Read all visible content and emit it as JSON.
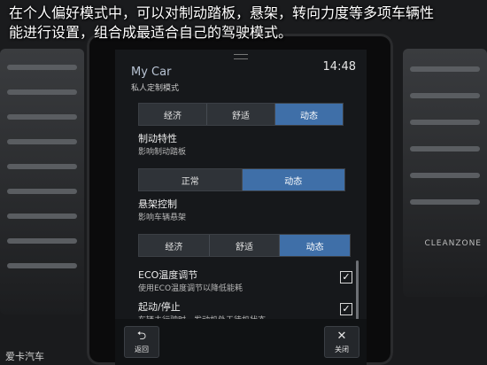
{
  "caption": {
    "line1": "在个人偏好模式中，可以对制动踏板，悬架，转向力度等多项车辆性",
    "line2": "能进行设置，组合成最适合自己的驾驶模式。"
  },
  "header": {
    "title": "My Car",
    "subtitle": "私人定制模式",
    "time": "14:48"
  },
  "top_selector": {
    "options": [
      "经济",
      "舒适",
      "动态"
    ],
    "active": "动态"
  },
  "brake": {
    "title": "制动特性",
    "subtitle": "影响制动踏板",
    "options": [
      "正常",
      "动态"
    ],
    "active": "动态"
  },
  "suspension": {
    "title": "悬架控制",
    "subtitle": "影响车辆悬架",
    "options": [
      "经济",
      "舒适",
      "动态"
    ],
    "active": "动态"
  },
  "eco_climate": {
    "title": "ECO温度调节",
    "subtitle": "使用ECO温度调节以降低能耗",
    "checked": true
  },
  "start_stop": {
    "title": "起动/停止",
    "subtitle": "车辆未行驶时，发动机处于待机状态",
    "checked": true
  },
  "footer": {
    "back_label": "返回",
    "close_label": "关闭"
  },
  "dashboard": {
    "cleanzone": "CLEANZONE",
    "watermark": "爱卡汽车"
  },
  "colors": {
    "active_segment": "#3f6fa8",
    "screen_bg": "#16181b"
  }
}
